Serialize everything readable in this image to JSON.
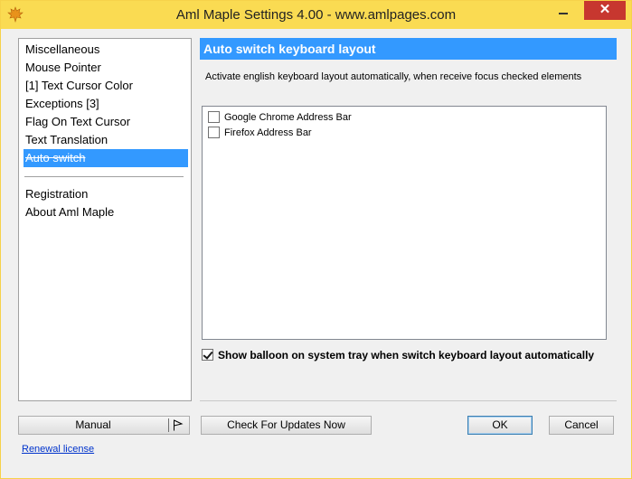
{
  "window": {
    "title": "Aml Maple Settings 4.00 - www.amlpages.com",
    "close_glyph": "✕"
  },
  "nav": {
    "items": [
      {
        "label": "Miscellaneous"
      },
      {
        "label": "Mouse Pointer"
      },
      {
        "label": "[1] Text Cursor Color"
      },
      {
        "label": "Exceptions [3]"
      },
      {
        "label": "Flag On Text Cursor"
      },
      {
        "label": "Text Translation"
      },
      {
        "label": "Auto switch",
        "selected": true
      }
    ],
    "bottom_items": [
      {
        "label": "Registration"
      },
      {
        "label": "About Aml Maple"
      }
    ]
  },
  "content": {
    "header": "Auto switch keyboard layout",
    "description": "Activate english keyboard layout automatically, when receive focus checked elements",
    "elements": [
      {
        "label": "Google Chrome Address Bar",
        "checked": false
      },
      {
        "label": "Firefox Address Bar",
        "checked": false
      }
    ],
    "balloon_option": {
      "label": "Show balloon on system tray when switch keyboard layout automatically",
      "checked": true
    }
  },
  "footer": {
    "manual_label": "Manual",
    "updates_label": "Check For Updates Now",
    "ok_label": "OK",
    "cancel_label": "Cancel",
    "renewal_link": "Renewal license"
  },
  "colors": {
    "titlebar": "#fadb52",
    "accent": "#3399ff",
    "close": "#c7372f",
    "link": "#0033cc"
  }
}
